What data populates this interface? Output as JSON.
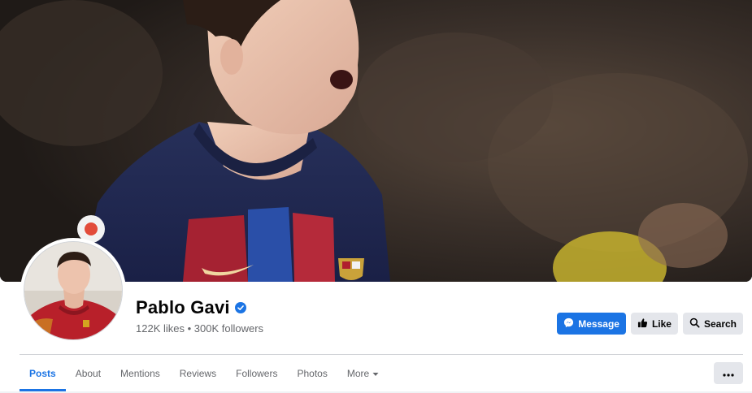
{
  "profile": {
    "name": "Pablo Gavi",
    "verified": true,
    "stats": "122K likes • 300K followers"
  },
  "actions": {
    "message_label": "Message",
    "like_label": "Like",
    "search_label": "Search"
  },
  "tabs": [
    {
      "label": "Posts",
      "active": true
    },
    {
      "label": "About",
      "active": false
    },
    {
      "label": "Mentions",
      "active": false
    },
    {
      "label": "Reviews",
      "active": false
    },
    {
      "label": "Followers",
      "active": false
    },
    {
      "label": "Photos",
      "active": false
    },
    {
      "label": "More",
      "active": false
    }
  ],
  "colors": {
    "accent": "#1b74e4",
    "secondary_button": "#e4e6eb",
    "muted_text": "#65676b"
  },
  "icons": {
    "message": "messenger-icon",
    "like": "thumbs-up-icon",
    "search": "search-icon",
    "more": "ellipsis-icon",
    "verified": "verified-badge-icon"
  }
}
